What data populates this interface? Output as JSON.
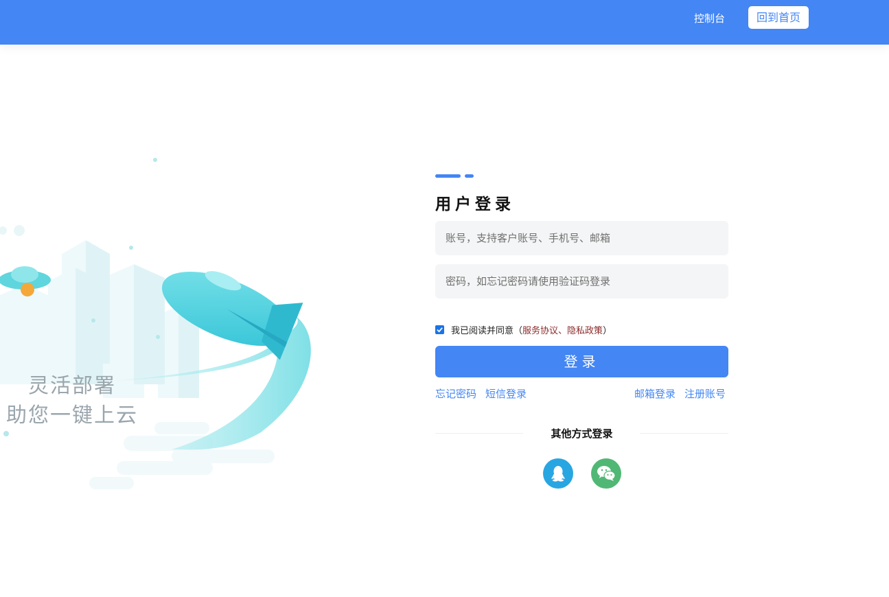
{
  "header": {
    "console_label": "控制台",
    "home_label": "回到首页",
    "bg_color": "#4386f4"
  },
  "illustration": {
    "slogan_line1": "灵活部署",
    "slogan_line2": "助您一键上云"
  },
  "login": {
    "title": "用户登录",
    "account_placeholder": "账号，支持客户账号、手机号、邮箱",
    "password_placeholder": "密码，如忘记密码请使用验证码登录",
    "agree": {
      "checked": true,
      "prefix": "我已阅读并同意（",
      "service_label": "服务协议",
      "separator": "、",
      "privacy_label": "隐私政策",
      "suffix": "）"
    },
    "submit_label": "登录",
    "links": {
      "forgot": "忘记密码",
      "sms": "短信登录",
      "email": "邮箱登录",
      "register": "注册账号"
    },
    "other_title": "其他方式登录",
    "social": [
      {
        "name": "qq-icon",
        "color": "#28a6e2"
      },
      {
        "name": "wechat-icon",
        "color": "#50b874"
      }
    ]
  }
}
